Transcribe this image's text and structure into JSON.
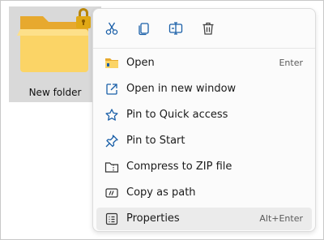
{
  "desktop": {
    "folder": {
      "name": "New folder",
      "icon": "locked-folder-icon"
    }
  },
  "context_menu": {
    "toolbar": [
      {
        "name": "cut",
        "icon": "scissors-icon"
      },
      {
        "name": "copy",
        "icon": "copy-icon"
      },
      {
        "name": "rename",
        "icon": "rename-icon"
      },
      {
        "name": "delete",
        "icon": "trash-icon"
      }
    ],
    "items": [
      {
        "label": "Open",
        "shortcut": "Enter",
        "icon": "folder-icon"
      },
      {
        "label": "Open in new window",
        "shortcut": "",
        "icon": "open-new-window-icon"
      },
      {
        "label": "Pin to Quick access",
        "shortcut": "",
        "icon": "star-icon"
      },
      {
        "label": "Pin to Start",
        "shortcut": "",
        "icon": "pin-icon"
      },
      {
        "label": "Compress to ZIP file",
        "shortcut": "",
        "icon": "zip-folder-icon"
      },
      {
        "label": "Copy as path",
        "shortcut": "",
        "icon": "copy-path-icon"
      },
      {
        "label": "Properties",
        "shortcut": "Alt+Enter",
        "icon": "properties-icon"
      }
    ],
    "highlighted_item": "Properties"
  },
  "colors": {
    "accent": "#0067c0",
    "folder_yellow": "#f7c948",
    "lock_gold": "#e0a816",
    "menu_background": "#fbfbfb",
    "hover_background": "#ebebeb"
  }
}
